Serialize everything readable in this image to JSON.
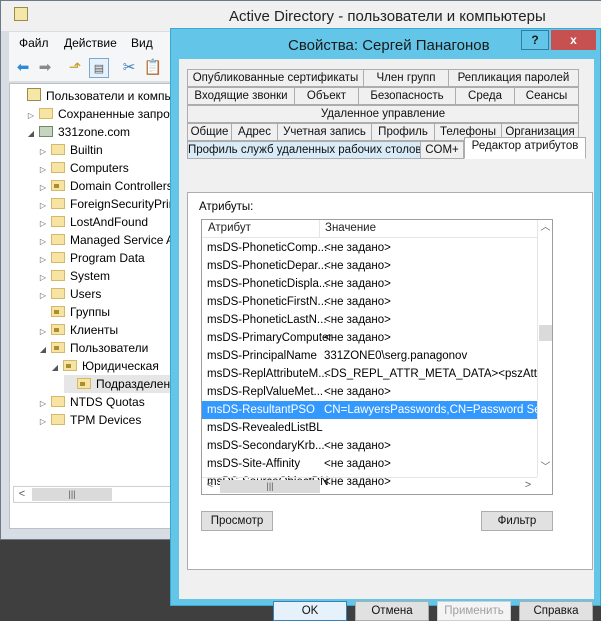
{
  "main_window": {
    "title": "Active Directory - пользователи и компьютеры",
    "menu": [
      "Файл",
      "Действие",
      "Вид"
    ],
    "toolbar": [
      "back-arrow-icon",
      "forward-arrow-icon",
      "up-folder-icon",
      "show-hide-tree-icon",
      "cut-icon",
      "paste-icon"
    ],
    "tree": [
      {
        "label": "Пользователи и компьютеры Active Directory",
        "level": 0,
        "expander": "",
        "icon": "snapin-icon"
      },
      {
        "label": "Сохраненные запросы",
        "level": 1,
        "expander": "▷",
        "icon": "folder-icon"
      },
      {
        "label": "331zone.com",
        "level": 1,
        "expander": "◢",
        "icon": "domain-icon"
      },
      {
        "label": "Builtin",
        "level": 2,
        "expander": "▷",
        "icon": "folder-icon"
      },
      {
        "label": "Computers",
        "level": 2,
        "expander": "▷",
        "icon": "folder-icon"
      },
      {
        "label": "Domain Controllers",
        "level": 2,
        "expander": "▷",
        "icon": "ou-icon"
      },
      {
        "label": "ForeignSecurityPrincipals",
        "level": 2,
        "expander": "▷",
        "icon": "folder-icon"
      },
      {
        "label": "LostAndFound",
        "level": 2,
        "expander": "▷",
        "icon": "folder-icon"
      },
      {
        "label": "Managed Service Accounts",
        "level": 2,
        "expander": "▷",
        "icon": "folder-icon"
      },
      {
        "label": "Program Data",
        "level": 2,
        "expander": "▷",
        "icon": "folder-icon"
      },
      {
        "label": "System",
        "level": 2,
        "expander": "▷",
        "icon": "folder-icon"
      },
      {
        "label": "Users",
        "level": 2,
        "expander": "▷",
        "icon": "folder-icon"
      },
      {
        "label": "Группы",
        "level": 2,
        "expander": "",
        "icon": "ou-icon"
      },
      {
        "label": "Клиенты",
        "level": 2,
        "expander": "▷",
        "icon": "ou-icon"
      },
      {
        "label": "Пользователи",
        "level": 2,
        "expander": "◢",
        "icon": "ou-icon"
      },
      {
        "label": "Юридическая",
        "level": 3,
        "expander": "◢",
        "icon": "ou-icon"
      },
      {
        "label": "Подразделение",
        "level": 4,
        "expander": "",
        "icon": "ou-icon",
        "selected": true
      },
      {
        "label": "NTDS Quotas",
        "level": 2,
        "expander": "▷",
        "icon": "folder-icon"
      },
      {
        "label": "TPM Devices",
        "level": 2,
        "expander": "▷",
        "icon": "folder-icon"
      }
    ]
  },
  "dialog": {
    "title": "Свойства: Сергей Панагонов",
    "help_label": "?",
    "close_label": "x",
    "tab_rows": [
      [
        "Опубликованные сертификаты",
        "Член групп",
        "Репликация паролей"
      ],
      [
        "Входящие звонки",
        "Объект",
        "Безопасность",
        "Среда",
        "Сеансы"
      ],
      [
        "Удаленное управление"
      ],
      [
        "Общие",
        "Адрес",
        "Учетная запись",
        "Профиль",
        "Телефоны",
        "Организация"
      ],
      [
        "Профиль служб удаленных рабочих столов",
        "COM+",
        "Редактор атрибутов"
      ]
    ],
    "active_tab": "Редактор атрибутов",
    "attributes_label": "Атрибуты:",
    "columns": [
      "Атрибут",
      "Значение"
    ],
    "rows": [
      {
        "attr": "msDS-PhoneticComp...",
        "value": "<не задано>"
      },
      {
        "attr": "msDS-PhoneticDepar...",
        "value": "<не задано>"
      },
      {
        "attr": "msDS-PhoneticDispla...",
        "value": "<не задано>"
      },
      {
        "attr": "msDS-PhoneticFirstN...",
        "value": "<не задано>"
      },
      {
        "attr": "msDS-PhoneticLastN...",
        "value": "<не задано>"
      },
      {
        "attr": "msDS-PrimaryComputer",
        "value": "<не задано>"
      },
      {
        "attr": "msDS-PrincipalName",
        "value": "331ZONE0\\serg.panagonov"
      },
      {
        "attr": "msDS-ReplAttributeM...",
        "value": "<DS_REPL_ATTR_META_DATA><pszAttrib"
      },
      {
        "attr": "msDS-ReplValueMet...",
        "value": "<не задано>"
      },
      {
        "attr": "msDS-ResultantPSO",
        "value": "CN=LawyersPasswords,CN=Password Settin",
        "selected": true
      },
      {
        "attr": "msDS-RevealedListBL",
        "value": ""
      },
      {
        "attr": "msDS-SecondaryKrb...",
        "value": "<не задано>"
      },
      {
        "attr": "msDS-Site-Affinity",
        "value": "<не задано>"
      },
      {
        "attr": "msDS-SourceObjectDN",
        "value": "<не задано>"
      }
    ],
    "view_button": "Просмотр",
    "filter_button": "Фильтр",
    "ok_button": "OK",
    "cancel_button": "Отмена",
    "apply_button": "Применить",
    "help_button": "Справка",
    "selection_color": "#3399ff",
    "title_bar_color": "#63c6e8",
    "close_color": "#c75050"
  }
}
